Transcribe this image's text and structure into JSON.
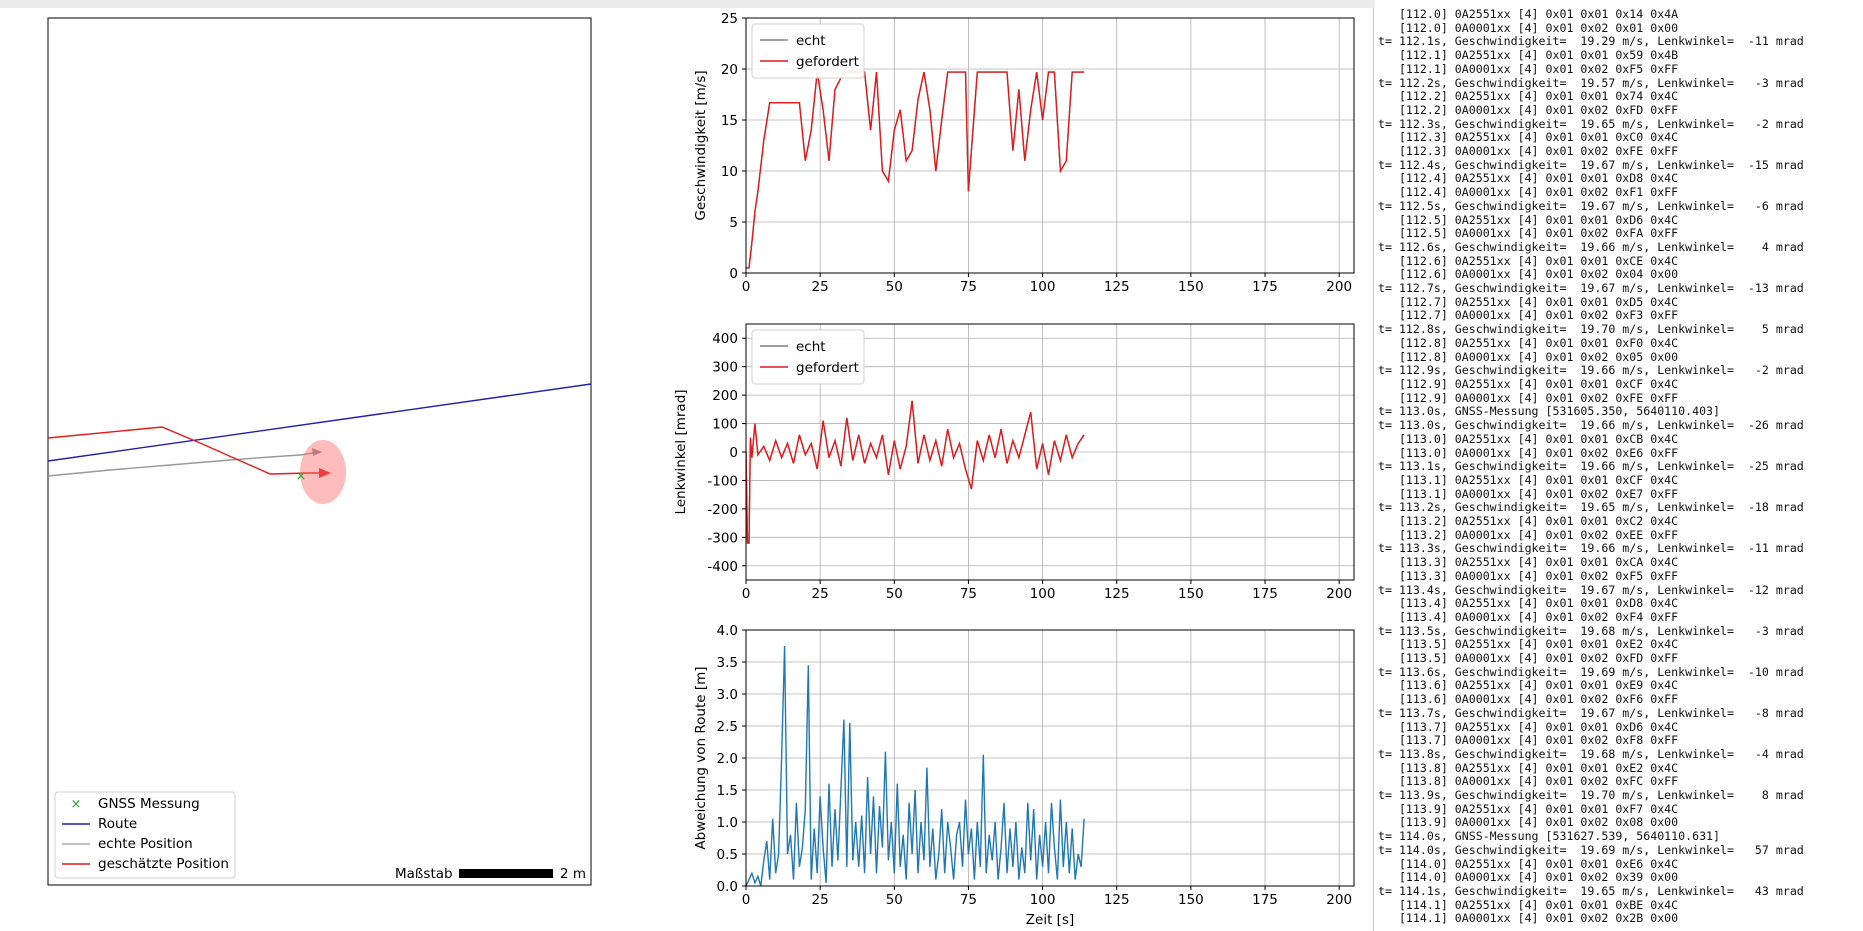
{
  "map": {
    "legend": [
      "GNSS Messung",
      "Route",
      "echte Position",
      "geschätzte Position"
    ],
    "scale_label": "Maßstab",
    "scale_value": "2 m",
    "colors": {
      "gnss": "#2ca02c",
      "route": "#1f1fa8",
      "real": "#999999",
      "estimated": "#e31a1c"
    }
  },
  "chart_data": [
    {
      "type": "line",
      "ylabel": "Geschwindigkeit [m/s]",
      "xlabel": "",
      "xlim": [
        0,
        205
      ],
      "ylim": [
        0,
        25
      ],
      "xticks": [
        0,
        25,
        50,
        75,
        100,
        125,
        150,
        175,
        200
      ],
      "yticks": [
        0,
        5,
        10,
        15,
        20,
        25
      ],
      "legend": "top-left",
      "grid": true,
      "series": [
        {
          "name": "echt",
          "color": "#808080",
          "x": [
            0,
            1,
            2,
            3,
            4,
            6,
            8,
            12,
            15,
            18,
            20,
            22,
            24,
            26,
            28,
            30,
            33,
            36,
            38,
            40,
            42,
            44,
            46,
            48,
            50,
            52,
            54,
            56,
            58,
            60,
            62,
            64,
            66,
            68,
            70,
            72,
            74,
            75,
            76,
            78,
            80,
            84,
            88,
            90,
            92,
            94,
            96,
            98,
            100,
            102,
            104,
            106,
            108,
            110,
            112,
            114
          ],
          "y": [
            0.5,
            0.5,
            3,
            6,
            8,
            13,
            16.7,
            16.7,
            16.7,
            16.7,
            11,
            14,
            19.7,
            16,
            11,
            18,
            19.7,
            19.7,
            19.7,
            19.7,
            14,
            19.7,
            10,
            9,
            14,
            16,
            11,
            12,
            17,
            19.7,
            16,
            10,
            15,
            19.7,
            19.7,
            19.7,
            19.7,
            8,
            12,
            19.7,
            19.7,
            19.7,
            19.7,
            12,
            18,
            11,
            16,
            19.7,
            15,
            19.7,
            19.7,
            10,
            11,
            19.7,
            19.7,
            19.7
          ]
        },
        {
          "name": "gefordert",
          "color": "#e31a1c",
          "x": [
            0,
            1,
            2,
            3,
            4,
            6,
            8,
            12,
            15,
            18,
            20,
            22,
            24,
            26,
            28,
            30,
            33,
            36,
            38,
            40,
            42,
            44,
            46,
            48,
            50,
            52,
            54,
            56,
            58,
            60,
            62,
            64,
            66,
            68,
            70,
            72,
            74,
            75,
            76,
            78,
            80,
            84,
            88,
            90,
            92,
            94,
            96,
            98,
            100,
            102,
            104,
            106,
            108,
            110,
            112,
            114
          ],
          "y": [
            0.5,
            0.5,
            3,
            6,
            8,
            13,
            16.7,
            16.7,
            16.7,
            16.7,
            11,
            14,
            19.7,
            16,
            11,
            18,
            19.7,
            19.7,
            19.7,
            19.7,
            14,
            19.7,
            10,
            9,
            14,
            16,
            11,
            12,
            17,
            19.7,
            16,
            10,
            15,
            19.7,
            19.7,
            19.7,
            19.7,
            8,
            12,
            19.7,
            19.7,
            19.7,
            19.7,
            12,
            18,
            11,
            16,
            19.7,
            15,
            19.7,
            19.7,
            10,
            11,
            19.7,
            19.7,
            19.7
          ]
        }
      ]
    },
    {
      "type": "line",
      "ylabel": "Lenkwinkel [mrad]",
      "xlabel": "",
      "xlim": [
        0,
        205
      ],
      "ylim": [
        -450,
        450
      ],
      "xticks": [
        0,
        25,
        50,
        75,
        100,
        125,
        150,
        175,
        200
      ],
      "yticks": [
        -400,
        -300,
        -200,
        -100,
        0,
        100,
        200,
        300,
        400
      ],
      "legend": "top-left",
      "grid": true,
      "series": [
        {
          "name": "echt",
          "color": "#808080",
          "x": [
            0,
            0.5,
            1,
            1.5,
            2,
            3,
            4,
            6,
            8,
            10,
            12,
            14,
            16,
            18,
            20,
            22,
            24,
            26,
            28,
            30,
            32,
            34,
            36,
            38,
            40,
            42,
            44,
            46,
            48,
            50,
            52,
            54,
            56,
            58,
            60,
            62,
            64,
            66,
            68,
            70,
            72,
            74,
            76,
            78,
            80,
            82,
            84,
            86,
            88,
            90,
            92,
            94,
            96,
            98,
            100,
            102,
            104,
            106,
            108,
            110,
            112,
            114
          ],
          "y": [
            0,
            -320,
            -320,
            50,
            -20,
            100,
            -10,
            20,
            -30,
            40,
            -20,
            30,
            -40,
            60,
            -10,
            30,
            -60,
            110,
            -20,
            40,
            -50,
            120,
            -30,
            60,
            -40,
            30,
            -20,
            60,
            -80,
            40,
            -60,
            20,
            180,
            -40,
            60,
            -30,
            40,
            -50,
            80,
            -20,
            30,
            -60,
            -130,
            40,
            -30,
            60,
            -20,
            80,
            -40,
            40,
            -20,
            60,
            140,
            -60,
            30,
            -80,
            40,
            -30,
            60,
            -20,
            30,
            60
          ]
        },
        {
          "name": "gefordert",
          "color": "#e31a1c",
          "x": [
            0,
            0.5,
            1,
            1.5,
            2,
            3,
            4,
            6,
            8,
            10,
            12,
            14,
            16,
            18,
            20,
            22,
            24,
            26,
            28,
            30,
            32,
            34,
            36,
            38,
            40,
            42,
            44,
            46,
            48,
            50,
            52,
            54,
            56,
            58,
            60,
            62,
            64,
            66,
            68,
            70,
            72,
            74,
            76,
            78,
            80,
            82,
            84,
            86,
            88,
            90,
            92,
            94,
            96,
            98,
            100,
            102,
            104,
            106,
            108,
            110,
            112,
            114
          ],
          "y": [
            0,
            -320,
            -320,
            50,
            -20,
            100,
            -10,
            20,
            -30,
            40,
            -20,
            30,
            -40,
            60,
            -10,
            30,
            -60,
            110,
            -20,
            40,
            -50,
            120,
            -30,
            60,
            -40,
            30,
            -20,
            60,
            -80,
            40,
            -60,
            20,
            180,
            -40,
            60,
            -30,
            40,
            -50,
            80,
            -20,
            30,
            -60,
            -130,
            40,
            -30,
            60,
            -20,
            80,
            -40,
            40,
            -20,
            60,
            140,
            -60,
            30,
            -80,
            40,
            -30,
            60,
            -20,
            30,
            60
          ]
        }
      ]
    },
    {
      "type": "line",
      "ylabel": "Abweichung von Route [m]",
      "xlabel": "Zeit [s]",
      "xlim": [
        0,
        205
      ],
      "ylim": [
        0,
        4
      ],
      "xticks": [
        0,
        25,
        50,
        75,
        100,
        125,
        150,
        175,
        200
      ],
      "yticks": [
        0.0,
        0.5,
        1.0,
        1.5,
        2.0,
        2.5,
        3.0,
        3.5,
        4.0
      ],
      "legend": "none",
      "grid": true,
      "series": [
        {
          "name": "",
          "color": "#1f77b4",
          "x": [
            0,
            1,
            2,
            3,
            4,
            5,
            6,
            7,
            8,
            9,
            10,
            11,
            12,
            13,
            14,
            15,
            16,
            17,
            18,
            19,
            20,
            21,
            22,
            23,
            24,
            25,
            26,
            27,
            28,
            29,
            30,
            31,
            32,
            33,
            34,
            35,
            36,
            37,
            38,
            39,
            40,
            41,
            42,
            43,
            44,
            45,
            46,
            47,
            48,
            49,
            50,
            51,
            52,
            53,
            54,
            55,
            56,
            57,
            58,
            59,
            60,
            61,
            62,
            63,
            64,
            65,
            66,
            67,
            68,
            69,
            70,
            71,
            72,
            73,
            74,
            75,
            76,
            77,
            78,
            79,
            80,
            81,
            82,
            83,
            84,
            85,
            86,
            87,
            88,
            89,
            90,
            91,
            92,
            93,
            94,
            95,
            96,
            97,
            98,
            99,
            100,
            101,
            102,
            103,
            104,
            105,
            106,
            107,
            108,
            109,
            110,
            111,
            112,
            113,
            114
          ],
          "y": [
            0,
            0.1,
            0.2,
            0.05,
            0.15,
            0,
            0.4,
            0.7,
            0.1,
            1.05,
            0.2,
            0.5,
            2.0,
            3.75,
            0.5,
            0.8,
            0.1,
            1.3,
            0.3,
            0.6,
            1.2,
            3.45,
            0.1,
            0.9,
            0.2,
            1.4,
            0.6,
            0.05,
            1.6,
            0.3,
            1.2,
            0.4,
            1.5,
            2.6,
            0.3,
            2.55,
            0.4,
            1.0,
            0.3,
            1.1,
            0.2,
            1.7,
            0.5,
            1.4,
            0.2,
            1.25,
            0.6,
            2.1,
            0.4,
            1.0,
            0.2,
            1.6,
            0.3,
            0.8,
            0.1,
            1.3,
            0.5,
            1.5,
            0.2,
            1.0,
            0.4,
            1.85,
            0.3,
            0.9,
            0.1,
            0.5,
            1.2,
            0.2,
            1.0,
            0.6,
            0.1,
            0.8,
            1.0,
            0.3,
            1.35,
            0.5,
            0.9,
            0.1,
            1.0,
            0.3,
            2.05,
            0.2,
            0.8,
            0.4,
            1.0,
            0.1,
            0.6,
            1.3,
            0.2,
            0.9,
            0.3,
            1.0,
            0.1,
            0.6,
            0.2,
            1.3,
            0.4,
            1.2,
            0.1,
            0.8,
            0.3,
            1.0,
            0.2,
            1.3,
            0.6,
            0.1,
            1.35,
            0.3,
            1.0,
            0.2,
            0.9,
            0.1,
            0.5,
            0.3,
            1.05
          ]
        }
      ]
    }
  ],
  "log": {
    "lines": [
      "   [112.0] 0A2551xx [4] 0x01 0x01 0x14 0x4A",
      "   [112.0] 0A0001xx [4] 0x01 0x02 0x01 0x00",
      "t= 112.1s, Geschwindigkeit=  19.29 m/s, Lenkwinkel=  -11 mrad",
      "   [112.1] 0A2551xx [4] 0x01 0x01 0x59 0x4B",
      "   [112.1] 0A0001xx [4] 0x01 0x02 0xF5 0xFF",
      "t= 112.2s, Geschwindigkeit=  19.57 m/s, Lenkwinkel=   -3 mrad",
      "   [112.2] 0A2551xx [4] 0x01 0x01 0x74 0x4C",
      "   [112.2] 0A0001xx [4] 0x01 0x02 0xFD 0xFF",
      "t= 112.3s, Geschwindigkeit=  19.65 m/s, Lenkwinkel=   -2 mrad",
      "   [112.3] 0A2551xx [4] 0x01 0x01 0xC0 0x4C",
      "   [112.3] 0A0001xx [4] 0x01 0x02 0xFE 0xFF",
      "t= 112.4s, Geschwindigkeit=  19.67 m/s, Lenkwinkel=  -15 mrad",
      "   [112.4] 0A2551xx [4] 0x01 0x01 0xD8 0x4C",
      "   [112.4] 0A0001xx [4] 0x01 0x02 0xF1 0xFF",
      "t= 112.5s, Geschwindigkeit=  19.67 m/s, Lenkwinkel=   -6 mrad",
      "   [112.5] 0A2551xx [4] 0x01 0x01 0xD6 0x4C",
      "   [112.5] 0A0001xx [4] 0x01 0x02 0xFA 0xFF",
      "t= 112.6s, Geschwindigkeit=  19.66 m/s, Lenkwinkel=    4 mrad",
      "   [112.6] 0A2551xx [4] 0x01 0x01 0xCE 0x4C",
      "   [112.6] 0A0001xx [4] 0x01 0x02 0x04 0x00",
      "t= 112.7s, Geschwindigkeit=  19.67 m/s, Lenkwinkel=  -13 mrad",
      "   [112.7] 0A2551xx [4] 0x01 0x01 0xD5 0x4C",
      "   [112.7] 0A0001xx [4] 0x01 0x02 0xF3 0xFF",
      "t= 112.8s, Geschwindigkeit=  19.70 m/s, Lenkwinkel=    5 mrad",
      "   [112.8] 0A2551xx [4] 0x01 0x01 0xF0 0x4C",
      "   [112.8] 0A0001xx [4] 0x01 0x02 0x05 0x00",
      "t= 112.9s, Geschwindigkeit=  19.66 m/s, Lenkwinkel=   -2 mrad",
      "   [112.9] 0A2551xx [4] 0x01 0x01 0xCF 0x4C",
      "   [112.9] 0A0001xx [4] 0x01 0x02 0xFE 0xFF",
      "t= 113.0s, GNSS-Messung [531605.350, 5640110.403]",
      "t= 113.0s, Geschwindigkeit=  19.66 m/s, Lenkwinkel=  -26 mrad",
      "   [113.0] 0A2551xx [4] 0x01 0x01 0xCB 0x4C",
      "   [113.0] 0A0001xx [4] 0x01 0x02 0xE6 0xFF",
      "t= 113.1s, Geschwindigkeit=  19.66 m/s, Lenkwinkel=  -25 mrad",
      "   [113.1] 0A2551xx [4] 0x01 0x01 0xCF 0x4C",
      "   [113.1] 0A0001xx [4] 0x01 0x02 0xE7 0xFF",
      "t= 113.2s, Geschwindigkeit=  19.65 m/s, Lenkwinkel=  -18 mrad",
      "   [113.2] 0A2551xx [4] 0x01 0x01 0xC2 0x4C",
      "   [113.2] 0A0001xx [4] 0x01 0x02 0xEE 0xFF",
      "t= 113.3s, Geschwindigkeit=  19.66 m/s, Lenkwinkel=  -11 mrad",
      "   [113.3] 0A2551xx [4] 0x01 0x01 0xCA 0x4C",
      "   [113.3] 0A0001xx [4] 0x01 0x02 0xF5 0xFF",
      "t= 113.4s, Geschwindigkeit=  19.67 m/s, Lenkwinkel=  -12 mrad",
      "   [113.4] 0A2551xx [4] 0x01 0x01 0xD8 0x4C",
      "   [113.4] 0A0001xx [4] 0x01 0x02 0xF4 0xFF",
      "t= 113.5s, Geschwindigkeit=  19.68 m/s, Lenkwinkel=   -3 mrad",
      "   [113.5] 0A2551xx [4] 0x01 0x01 0xE2 0x4C",
      "   [113.5] 0A0001xx [4] 0x01 0x02 0xFD 0xFF",
      "t= 113.6s, Geschwindigkeit=  19.69 m/s, Lenkwinkel=  -10 mrad",
      "   [113.6] 0A2551xx [4] 0x01 0x01 0xE9 0x4C",
      "   [113.6] 0A0001xx [4] 0x01 0x02 0xF6 0xFF",
      "t= 113.7s, Geschwindigkeit=  19.67 m/s, Lenkwinkel=   -8 mrad",
      "   [113.7] 0A2551xx [4] 0x01 0x01 0xD6 0x4C",
      "   [113.7] 0A0001xx [4] 0x01 0x02 0xF8 0xFF",
      "t= 113.8s, Geschwindigkeit=  19.68 m/s, Lenkwinkel=   -4 mrad",
      "   [113.8] 0A2551xx [4] 0x01 0x01 0xE2 0x4C",
      "   [113.8] 0A0001xx [4] 0x01 0x02 0xFC 0xFF",
      "t= 113.9s, Geschwindigkeit=  19.70 m/s, Lenkwinkel=    8 mrad",
      "   [113.9] 0A2551xx [4] 0x01 0x01 0xF7 0x4C",
      "   [113.9] 0A0001xx [4] 0x01 0x02 0x08 0x00",
      "t= 114.0s, GNSS-Messung [531627.539, 5640110.631]",
      "t= 114.0s, Geschwindigkeit=  19.69 m/s, Lenkwinkel=   57 mrad",
      "   [114.0] 0A2551xx [4] 0x01 0x01 0xE6 0x4C",
      "   [114.0] 0A0001xx [4] 0x01 0x02 0x39 0x00",
      "t= 114.1s, Geschwindigkeit=  19.65 m/s, Lenkwinkel=   43 mrad",
      "   [114.1] 0A2551xx [4] 0x01 0x01 0xBE 0x4C",
      "   [114.1] 0A0001xx [4] 0x01 0x02 0x2B 0x00"
    ]
  }
}
